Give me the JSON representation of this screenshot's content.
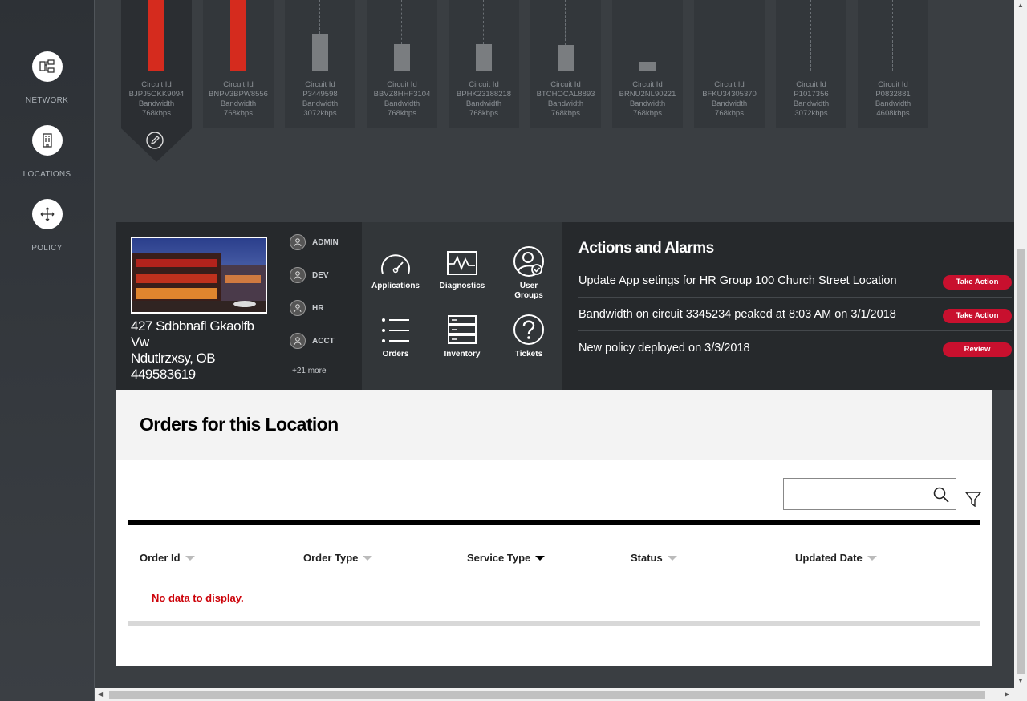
{
  "sidebar": {
    "items": [
      {
        "label": "NETWORK",
        "icon": "network-icon"
      },
      {
        "label": "LOCATIONS",
        "icon": "building-icon"
      },
      {
        "label": "POLICY",
        "icon": "move-arrows-icon"
      }
    ]
  },
  "circuits": [
    {
      "id_label": "Circuit Id",
      "id": "BJPJ5OKK9094",
      "bw_label": "Bandwidth",
      "bandwidth": "768kbps",
      "usage": 1.0,
      "status": "alert"
    },
    {
      "id_label": "Circuit Id",
      "id": "BNPV3BPW8556",
      "bw_label": "Bandwidth",
      "bandwidth": "768kbps",
      "usage": 1.0,
      "status": "alert"
    },
    {
      "id_label": "Circuit Id",
      "id": "P3449598",
      "bw_label": "Bandwidth",
      "bandwidth": "3072kbps",
      "usage": 0.52,
      "status": "normal"
    },
    {
      "id_label": "Circuit Id",
      "id": "BBVZ8HHF3104",
      "bw_label": "Bandwidth",
      "bandwidth": "768kbps",
      "usage": 0.38,
      "status": "normal"
    },
    {
      "id_label": "Circuit Id",
      "id": "BPHK23188218",
      "bw_label": "Bandwidth",
      "bandwidth": "768kbps",
      "usage": 0.38,
      "status": "normal"
    },
    {
      "id_label": "Circuit Id",
      "id": "BTCHOCAL8893",
      "bw_label": "Bandwidth",
      "bandwidth": "768kbps",
      "usage": 0.36,
      "status": "normal"
    },
    {
      "id_label": "Circuit Id",
      "id": "BRNU2NL90221",
      "bw_label": "Bandwidth",
      "bandwidth": "768kbps",
      "usage": 0.12,
      "status": "normal"
    },
    {
      "id_label": "Circuit Id",
      "id": "BFKU34305370",
      "bw_label": "Bandwidth",
      "bandwidth": "768kbps",
      "usage": 0,
      "status": "normal"
    },
    {
      "id_label": "Circuit Id",
      "id": "P1017356",
      "bw_label": "Bandwidth",
      "bandwidth": "3072kbps",
      "usage": 0,
      "status": "normal"
    },
    {
      "id_label": "Circuit Id",
      "id": "P0832881",
      "bw_label": "Bandwidth",
      "bandwidth": "4608kbps",
      "usage": 0,
      "status": "normal"
    }
  ],
  "location": {
    "address_line1": "427 Sdbbnafl Gkaolfb",
    "address_line2": "Vw",
    "address_line3": "Ndutlrzxsy, OB",
    "address_line4": "449583619",
    "groups": [
      "ADMIN",
      "DEV",
      "HR",
      "ACCT"
    ],
    "more": "+21 more"
  },
  "tiles": [
    {
      "label": "Applications",
      "icon": "gauge-icon"
    },
    {
      "label": "Diagnostics",
      "icon": "pulse-icon"
    },
    {
      "label": "User Groups",
      "icon": "user-check-icon"
    },
    {
      "label": "Orders",
      "icon": "list-icon"
    },
    {
      "label": "Inventory",
      "icon": "server-icon"
    },
    {
      "label": "Tickets",
      "icon": "question-icon"
    }
  ],
  "actions": {
    "title": "Actions and Alarms",
    "items": [
      {
        "text": "Update App setings for HR Group 100 Church Street Location",
        "button": "Take Action"
      },
      {
        "text": "Bandwidth on circuit 3345234 peaked at 8:03 AM on 3/1/2018",
        "button": "Take Action"
      },
      {
        "text": "New policy deployed on 3/3/2018",
        "button": "Review"
      }
    ]
  },
  "orders": {
    "title": "Orders for this Location",
    "search_value": "",
    "columns": [
      "Order Id",
      "Order Type",
      "Service Type",
      "Status",
      "Updated Date"
    ],
    "sorted_column": "Service Type",
    "empty_message": "No data to display."
  },
  "colors": {
    "accent": "#cd040b",
    "alert_bar": "#d52b1e",
    "normal_bar": "#7a7d80"
  }
}
